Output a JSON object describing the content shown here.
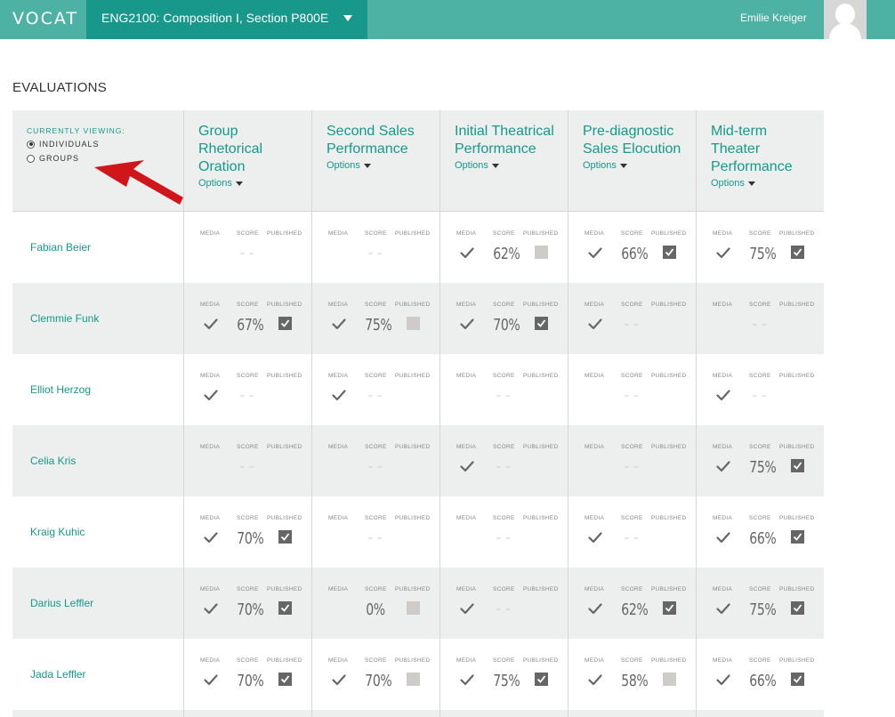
{
  "app": {
    "logo": "VOCAT"
  },
  "course": {
    "name": "ENG2100: Composition I, Section P800E"
  },
  "user": {
    "name": "Emilie Kreiger"
  },
  "page": {
    "title": "EVALUATIONS"
  },
  "viewing": {
    "label": "CURRENTLY VIEWING:",
    "options": [
      "INDIVIDUALS",
      "GROUPS"
    ],
    "selected": "INDIVIDUALS"
  },
  "columns": [
    {
      "title": "Group Rhetorical Oration",
      "options": "Options"
    },
    {
      "title": "Second Sales Performance",
      "options": "Options"
    },
    {
      "title": "Initial Theatrical Performance",
      "options": "Options"
    },
    {
      "title": "Pre-diagnostic Sales Elocution",
      "options": "Options"
    },
    {
      "title": "Mid-term Theater Performance",
      "options": "Options"
    }
  ],
  "sublabels": {
    "media": "MEDIA",
    "score": "SCORE",
    "published": "PUBLISHED"
  },
  "empty_score": "– –",
  "rows": [
    {
      "name": "Fabian Beier",
      "cells": [
        {
          "media": false,
          "score": null,
          "published": null
        },
        {
          "media": false,
          "score": null,
          "published": null
        },
        {
          "media": true,
          "score": "62%",
          "published": false
        },
        {
          "media": true,
          "score": "66%",
          "published": true
        },
        {
          "media": true,
          "score": "75%",
          "published": true
        }
      ]
    },
    {
      "name": "Clemmie Funk",
      "cells": [
        {
          "media": true,
          "score": "67%",
          "published": true
        },
        {
          "media": true,
          "score": "75%",
          "published": false
        },
        {
          "media": true,
          "score": "70%",
          "published": true
        },
        {
          "media": true,
          "score": null,
          "published": null
        },
        {
          "media": false,
          "score": null,
          "published": null
        }
      ]
    },
    {
      "name": "Elliot Herzog",
      "cells": [
        {
          "media": true,
          "score": null,
          "published": null
        },
        {
          "media": true,
          "score": null,
          "published": null
        },
        {
          "media": false,
          "score": null,
          "published": null
        },
        {
          "media": false,
          "score": null,
          "published": null
        },
        {
          "media": true,
          "score": null,
          "published": null
        }
      ]
    },
    {
      "name": "Celia Kris",
      "cells": [
        {
          "media": false,
          "score": null,
          "published": null
        },
        {
          "media": false,
          "score": null,
          "published": null
        },
        {
          "media": true,
          "score": null,
          "published": null
        },
        {
          "media": false,
          "score": null,
          "published": null
        },
        {
          "media": true,
          "score": "75%",
          "published": true
        }
      ]
    },
    {
      "name": "Kraig Kuhic",
      "cells": [
        {
          "media": true,
          "score": "70%",
          "published": true
        },
        {
          "media": false,
          "score": null,
          "published": null
        },
        {
          "media": false,
          "score": null,
          "published": null
        },
        {
          "media": true,
          "score": null,
          "published": null
        },
        {
          "media": true,
          "score": "66%",
          "published": true
        }
      ]
    },
    {
      "name": "Darius Leffler",
      "cells": [
        {
          "media": true,
          "score": "70%",
          "published": true
        },
        {
          "media": false,
          "score": "0%",
          "published": false
        },
        {
          "media": true,
          "score": null,
          "published": null
        },
        {
          "media": true,
          "score": "62%",
          "published": true
        },
        {
          "media": true,
          "score": "75%",
          "published": true
        }
      ]
    },
    {
      "name": "Jada Leffler",
      "cells": [
        {
          "media": true,
          "score": "70%",
          "published": true
        },
        {
          "media": true,
          "score": "70%",
          "published": false
        },
        {
          "media": true,
          "score": "75%",
          "published": true
        },
        {
          "media": true,
          "score": "58%",
          "published": false
        },
        {
          "media": true,
          "score": "66%",
          "published": true
        }
      ]
    }
  ],
  "colors": {
    "brand": "#4db1a4",
    "brand_dark": "#17988a",
    "annotation_arrow": "#d0161b"
  }
}
